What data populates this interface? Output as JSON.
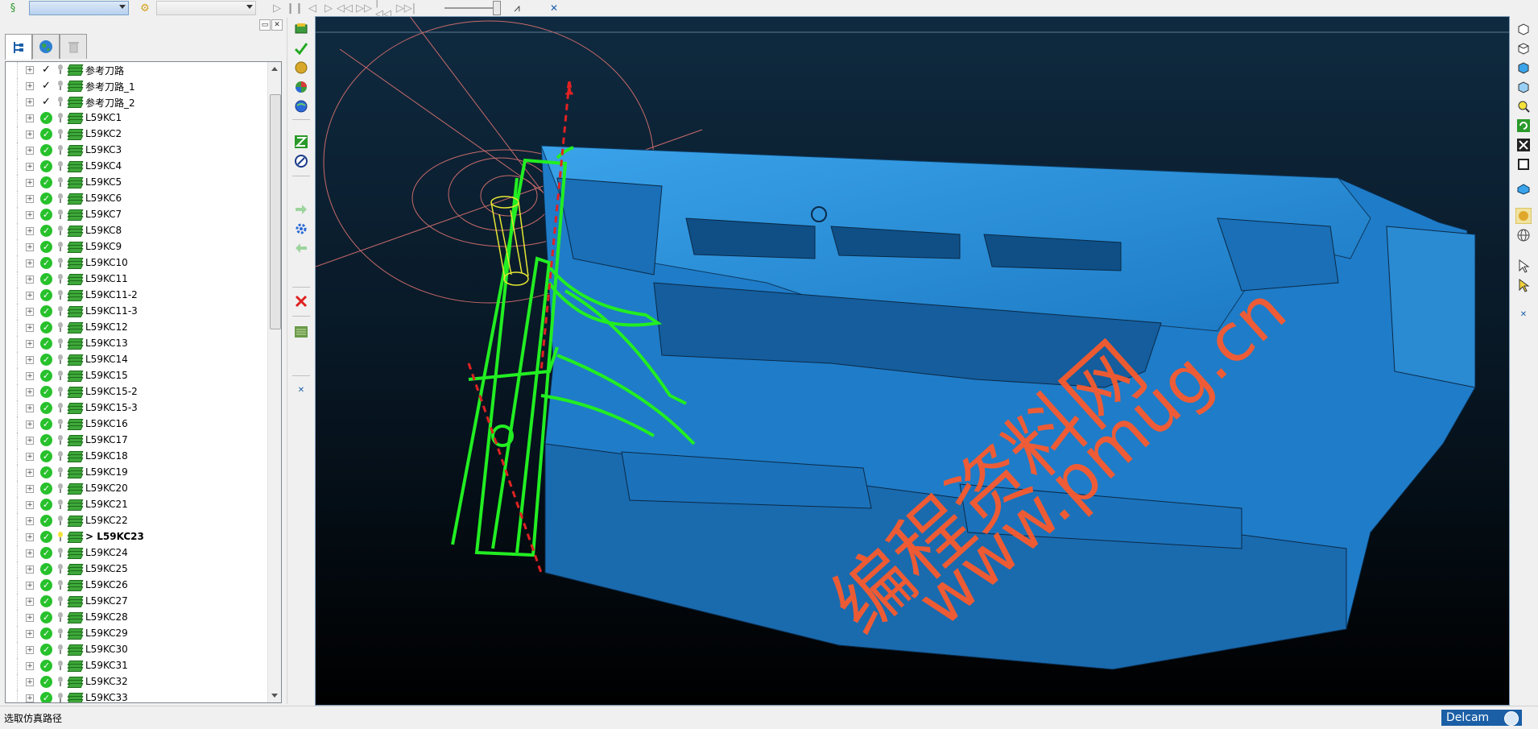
{
  "toolbar": {
    "workplane_combo_value": "",
    "tool_combo_value": "",
    "icons": [
      "simulation-icon",
      "tool-icon",
      "play-icon",
      "pause-icon",
      "step-back-icon",
      "step-forward-icon",
      "rewind-icon",
      "fast-forward-icon",
      "goto-start-icon",
      "goto-end-icon",
      "tool-path-icon",
      "close-icon"
    ]
  },
  "explorer": {
    "tabs": [
      {
        "name": "tree-tab",
        "icon": "tree-icon",
        "active": true
      },
      {
        "name": "globe-tab",
        "icon": "globe-icon",
        "active": false
      },
      {
        "name": "trash-tab",
        "icon": "trash-icon",
        "active": false
      }
    ],
    "items": [
      {
        "label": "参考刀路",
        "state": "tick",
        "bulb": "off",
        "bold": false
      },
      {
        "label": "参考刀路_1",
        "state": "tick",
        "bulb": "off",
        "bold": false
      },
      {
        "label": "参考刀路_2",
        "state": "tick",
        "bulb": "off",
        "bold": false
      },
      {
        "label": "L59KC1",
        "state": "ok",
        "bulb": "off",
        "bold": false
      },
      {
        "label": "L59KC2",
        "state": "ok",
        "bulb": "off",
        "bold": false
      },
      {
        "label": "L59KC3",
        "state": "ok",
        "bulb": "off",
        "bold": false
      },
      {
        "label": "L59KC4",
        "state": "ok",
        "bulb": "off",
        "bold": false
      },
      {
        "label": "L59KC5",
        "state": "ok",
        "bulb": "off",
        "bold": false
      },
      {
        "label": "L59KC6",
        "state": "ok",
        "bulb": "off",
        "bold": false
      },
      {
        "label": "L59KC7",
        "state": "ok",
        "bulb": "off",
        "bold": false
      },
      {
        "label": "L59KC8",
        "state": "ok",
        "bulb": "off",
        "bold": false
      },
      {
        "label": "L59KC9",
        "state": "ok",
        "bulb": "off",
        "bold": false
      },
      {
        "label": "L59KC10",
        "state": "ok",
        "bulb": "off",
        "bold": false
      },
      {
        "label": "L59KC11",
        "state": "ok",
        "bulb": "off",
        "bold": false
      },
      {
        "label": "L59KC11-2",
        "state": "ok",
        "bulb": "off",
        "bold": false
      },
      {
        "label": "L59KC11-3",
        "state": "ok",
        "bulb": "off",
        "bold": false
      },
      {
        "label": "L59KC12",
        "state": "ok",
        "bulb": "off",
        "bold": false
      },
      {
        "label": "L59KC13",
        "state": "ok",
        "bulb": "off",
        "bold": false
      },
      {
        "label": "L59KC14",
        "state": "ok",
        "bulb": "off",
        "bold": false
      },
      {
        "label": "L59KC15",
        "state": "ok",
        "bulb": "off",
        "bold": false
      },
      {
        "label": "L59KC15-2",
        "state": "ok",
        "bulb": "off",
        "bold": false
      },
      {
        "label": "L59KC15-3",
        "state": "ok",
        "bulb": "off",
        "bold": false
      },
      {
        "label": "L59KC16",
        "state": "ok",
        "bulb": "off",
        "bold": false
      },
      {
        "label": "L59KC17",
        "state": "ok",
        "bulb": "off",
        "bold": false
      },
      {
        "label": "L59KC18",
        "state": "ok",
        "bulb": "off",
        "bold": false
      },
      {
        "label": "L59KC19",
        "state": "ok",
        "bulb": "off",
        "bold": false
      },
      {
        "label": "L59KC20",
        "state": "ok",
        "bulb": "off",
        "bold": false
      },
      {
        "label": "L59KC21",
        "state": "ok",
        "bulb": "off",
        "bold": false
      },
      {
        "label": "L59KC22",
        "state": "ok",
        "bulb": "off",
        "bold": false
      },
      {
        "label": "> L59KC23",
        "state": "ok",
        "bulb": "on",
        "bold": true
      },
      {
        "label": "L59KC24",
        "state": "ok",
        "bulb": "off",
        "bold": false
      },
      {
        "label": "L59KC25",
        "state": "ok",
        "bulb": "off",
        "bold": false
      },
      {
        "label": "L59KC26",
        "state": "ok",
        "bulb": "off",
        "bold": false
      },
      {
        "label": "L59KC27",
        "state": "ok",
        "bulb": "off",
        "bold": false
      },
      {
        "label": "L59KC28",
        "state": "ok",
        "bulb": "off",
        "bold": false
      },
      {
        "label": "L59KC29",
        "state": "ok",
        "bulb": "off",
        "bold": false
      },
      {
        "label": "L59KC30",
        "state": "ok",
        "bulb": "off",
        "bold": false
      },
      {
        "label": "L59KC31",
        "state": "ok",
        "bulb": "off",
        "bold": false
      },
      {
        "label": "L59KC32",
        "state": "ok",
        "bulb": "off",
        "bold": false
      },
      {
        "label": "L59KC33",
        "state": "ok",
        "bulb": "off",
        "bold": false
      }
    ]
  },
  "middle_toolbar": [
    "calculator-icon",
    "accept-icon",
    "shaded-sphere-icon",
    "color-sphere-icon",
    "blue-sphere-icon",
    "path-z-icon",
    "compass-icon",
    "arrow-right-icon",
    "settings-icon",
    "arrow-left-icon",
    "delete-icon",
    "list-icon",
    "close-icon"
  ],
  "right_toolbar": [
    "view-iso-1-icon",
    "view-iso-2-icon",
    "view-iso-3-icon",
    "view-iso-4-icon",
    "zoom-icon",
    "refresh-icon",
    "zoom-extents-icon",
    "zoom-box-icon",
    "block-icon",
    "shaded-icon",
    "wireframe-icon",
    "select-icon",
    "pick-icon",
    "close-icon"
  ],
  "viewport": {
    "watermark_text": "www.pmug.cn",
    "watermark_cn": "编程资料网",
    "colors": {
      "background_top": "#0e2338",
      "background_bottom": "#000000",
      "model": "#2f8fd6",
      "toolpath": "#22ee22",
      "rapid": "#dd2222",
      "circles": "#c86a6a",
      "tool": "#e6e632",
      "watermark": "#ff5a2a"
    }
  },
  "status": {
    "text": "选取仿真路径",
    "brand": "Delcam"
  }
}
